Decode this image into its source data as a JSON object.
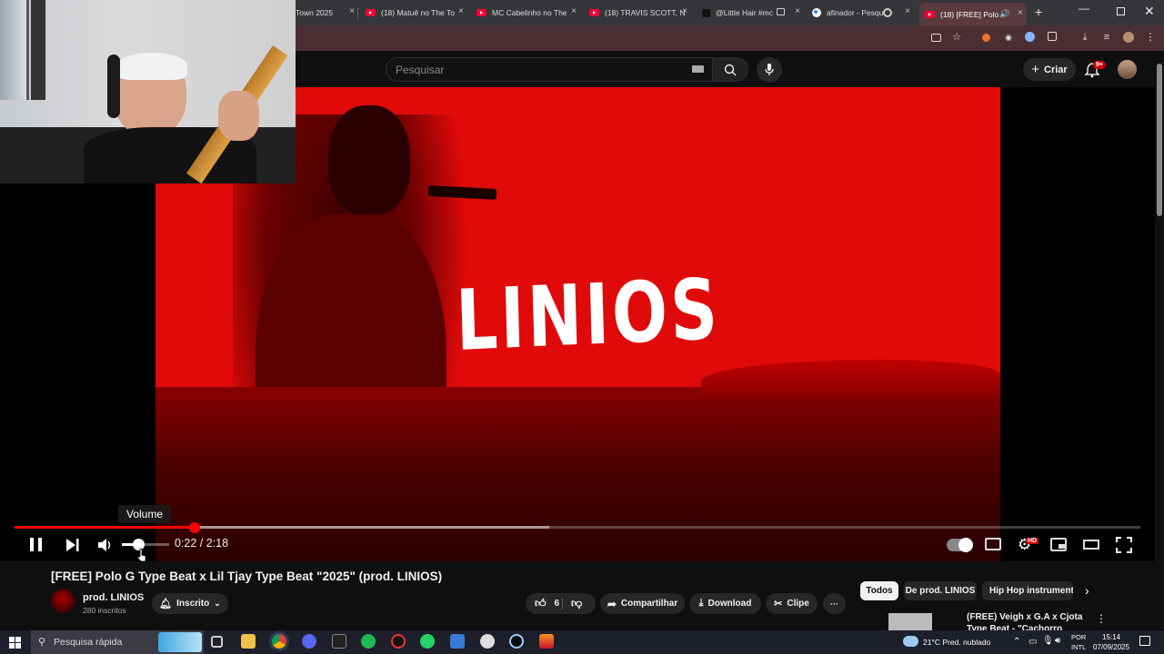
{
  "browser": {
    "tabs": [
      {
        "title": "Town 2025",
        "icon": "none"
      },
      {
        "title": "(18) Matuê no The To",
        "icon": "youtube-icon"
      },
      {
        "title": "MC Cabelinho no The",
        "icon": "youtube-icon"
      },
      {
        "title": "(18) TRAVIS SCOTT, N",
        "icon": "youtube-icon"
      },
      {
        "title": "@Little Hair #mc",
        "icon": "tiktok-icon"
      },
      {
        "title": "afinador - Pesqu",
        "icon": "google-icon"
      },
      {
        "title": "(18) [FREE] Polo G",
        "icon": "youtube-icon",
        "active": true
      }
    ],
    "close_glyph": "×",
    "new_tab_glyph": "+"
  },
  "youtube": {
    "search_placeholder": "Pesquisar",
    "create_label": "Criar",
    "notification_count": "9+"
  },
  "player": {
    "overlay_text": "LINIOS",
    "tooltip": "Volume",
    "time_display": "0:22 / 2:18",
    "progress_fraction": 0.16,
    "buffered_fraction": 0.475,
    "volume_fraction": 0.35,
    "quality_badge": "HD"
  },
  "video": {
    "title": "[FREE] Polo G Type Beat x Lil Tjay Type Beat \"2025\" (prod. LINIOS)",
    "channel_name": "prod. LINIOS",
    "subscribers": "280 inscritos",
    "subscribed_label": "Inscrito",
    "likes": "6",
    "share_label": "Compartilhar",
    "download_label": "Download",
    "clip_label": "Clipe",
    "more_glyph": "···"
  },
  "sidebar": {
    "chips": [
      "Todos",
      "De prod. LINIOS",
      "Hip Hop instrumental"
    ],
    "recommendation_title": "(FREE) Veigh x G.A x Cjota Type Beat - \"Cachorro Sincero\""
  },
  "taskbar": {
    "search_label": "Pesquisa rápida",
    "weather": "21°C  Pred. nublado",
    "lang_top": "POR",
    "lang_bottom": "INTL",
    "time": "15:14",
    "date": "07/09/2025"
  },
  "colors": {
    "accent": "#ff0000",
    "video_frame": "#e00a0a",
    "background": "#0f0f0f",
    "tab_active": "#5a3a3e"
  }
}
